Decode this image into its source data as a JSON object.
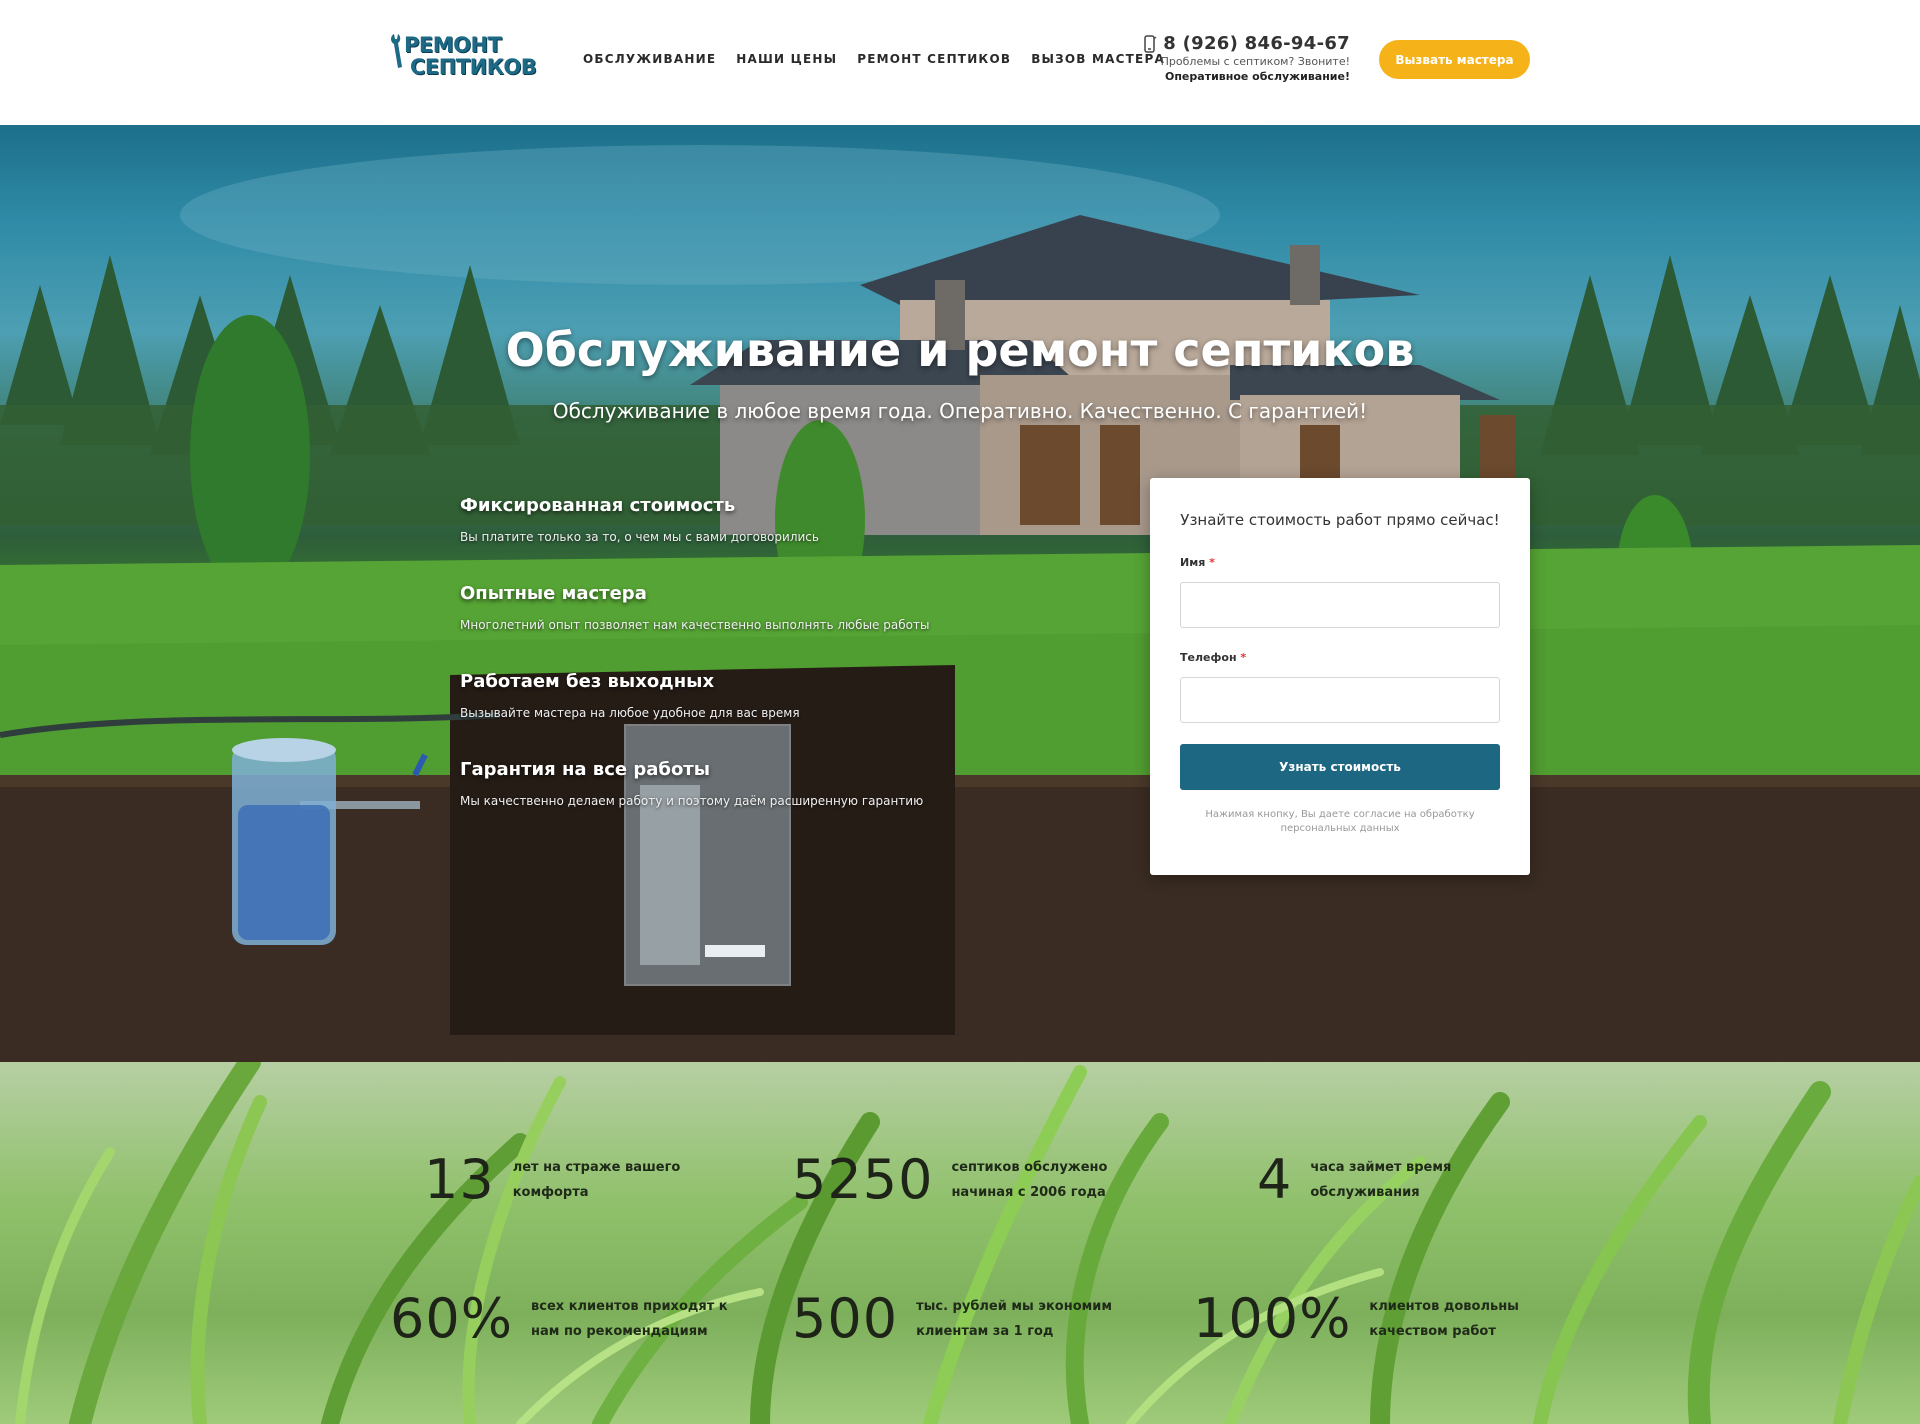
{
  "header": {
    "logo": {
      "line1": "РЕМОНТ",
      "line2": "СЕПТИКОВ"
    },
    "nav": [
      "ОБСЛУЖИВАНИЕ",
      "НАШИ ЦЕНЫ",
      "РЕМОНТ СЕПТИКОВ",
      "ВЫЗОВ МАСТЕРА"
    ],
    "phone": "8 (926) 846-94-67",
    "phone_sub1": "Проблемы с септиком? Звоните!",
    "phone_sub2": "Оперативное обслуживание!",
    "cta": "Вызвать мастера"
  },
  "hero": {
    "title": "Обслуживание и ремонт септиков",
    "subtitle": "Обслуживание в любое время года. Оперативно. Качественно. С гарантией!",
    "features": [
      {
        "title": "Фиксированная стоимость",
        "desc": "Вы платите только за то, о чем мы с вами договорились"
      },
      {
        "title": "Опытные мастера",
        "desc": "Многолетний опыт позволяет нам качественно выполнять любые работы"
      },
      {
        "title": "Работаем без выходных",
        "desc": "Вызывайте мастера на любое удобное для вас время"
      },
      {
        "title": "Гарантия на все работы",
        "desc": "Мы качественно делаем работу и поэтому даём расширенную гарантию"
      }
    ]
  },
  "form": {
    "title": "Узнайте стоимость работ прямо сейчас!",
    "name_label": "Имя",
    "phone_label": "Телефон",
    "required_mark": "*",
    "name_value": "",
    "phone_value": "",
    "submit": "Узнать стоимость",
    "note": "Нажимая кнопку, Вы даете согласие на обработку персональных данных"
  },
  "stats": [
    {
      "num": "13",
      "text1": "лет на страже вашего",
      "text2": "комфорта"
    },
    {
      "num": "5250",
      "text1": "септиков обслужено",
      "text2": "начиная с 2006 года"
    },
    {
      "num": "4",
      "text1": "часа займет время",
      "text2": "обслуживания"
    },
    {
      "num": "60%",
      "text1": "всех клиентов приходят к",
      "text2": "нам по рекомендациям"
    },
    {
      "num": "500",
      "text1": "тыс. рублей мы экономим",
      "text2": "клиентам за 1 год"
    },
    {
      "num": "100%",
      "text1": "клиентов довольны",
      "text2": "качеством работ"
    }
  ],
  "colors": {
    "brand": "#1d6783",
    "accent": "#f5b319"
  },
  "icons": {
    "phone": "phone-icon",
    "logo": "wrench-icon"
  }
}
